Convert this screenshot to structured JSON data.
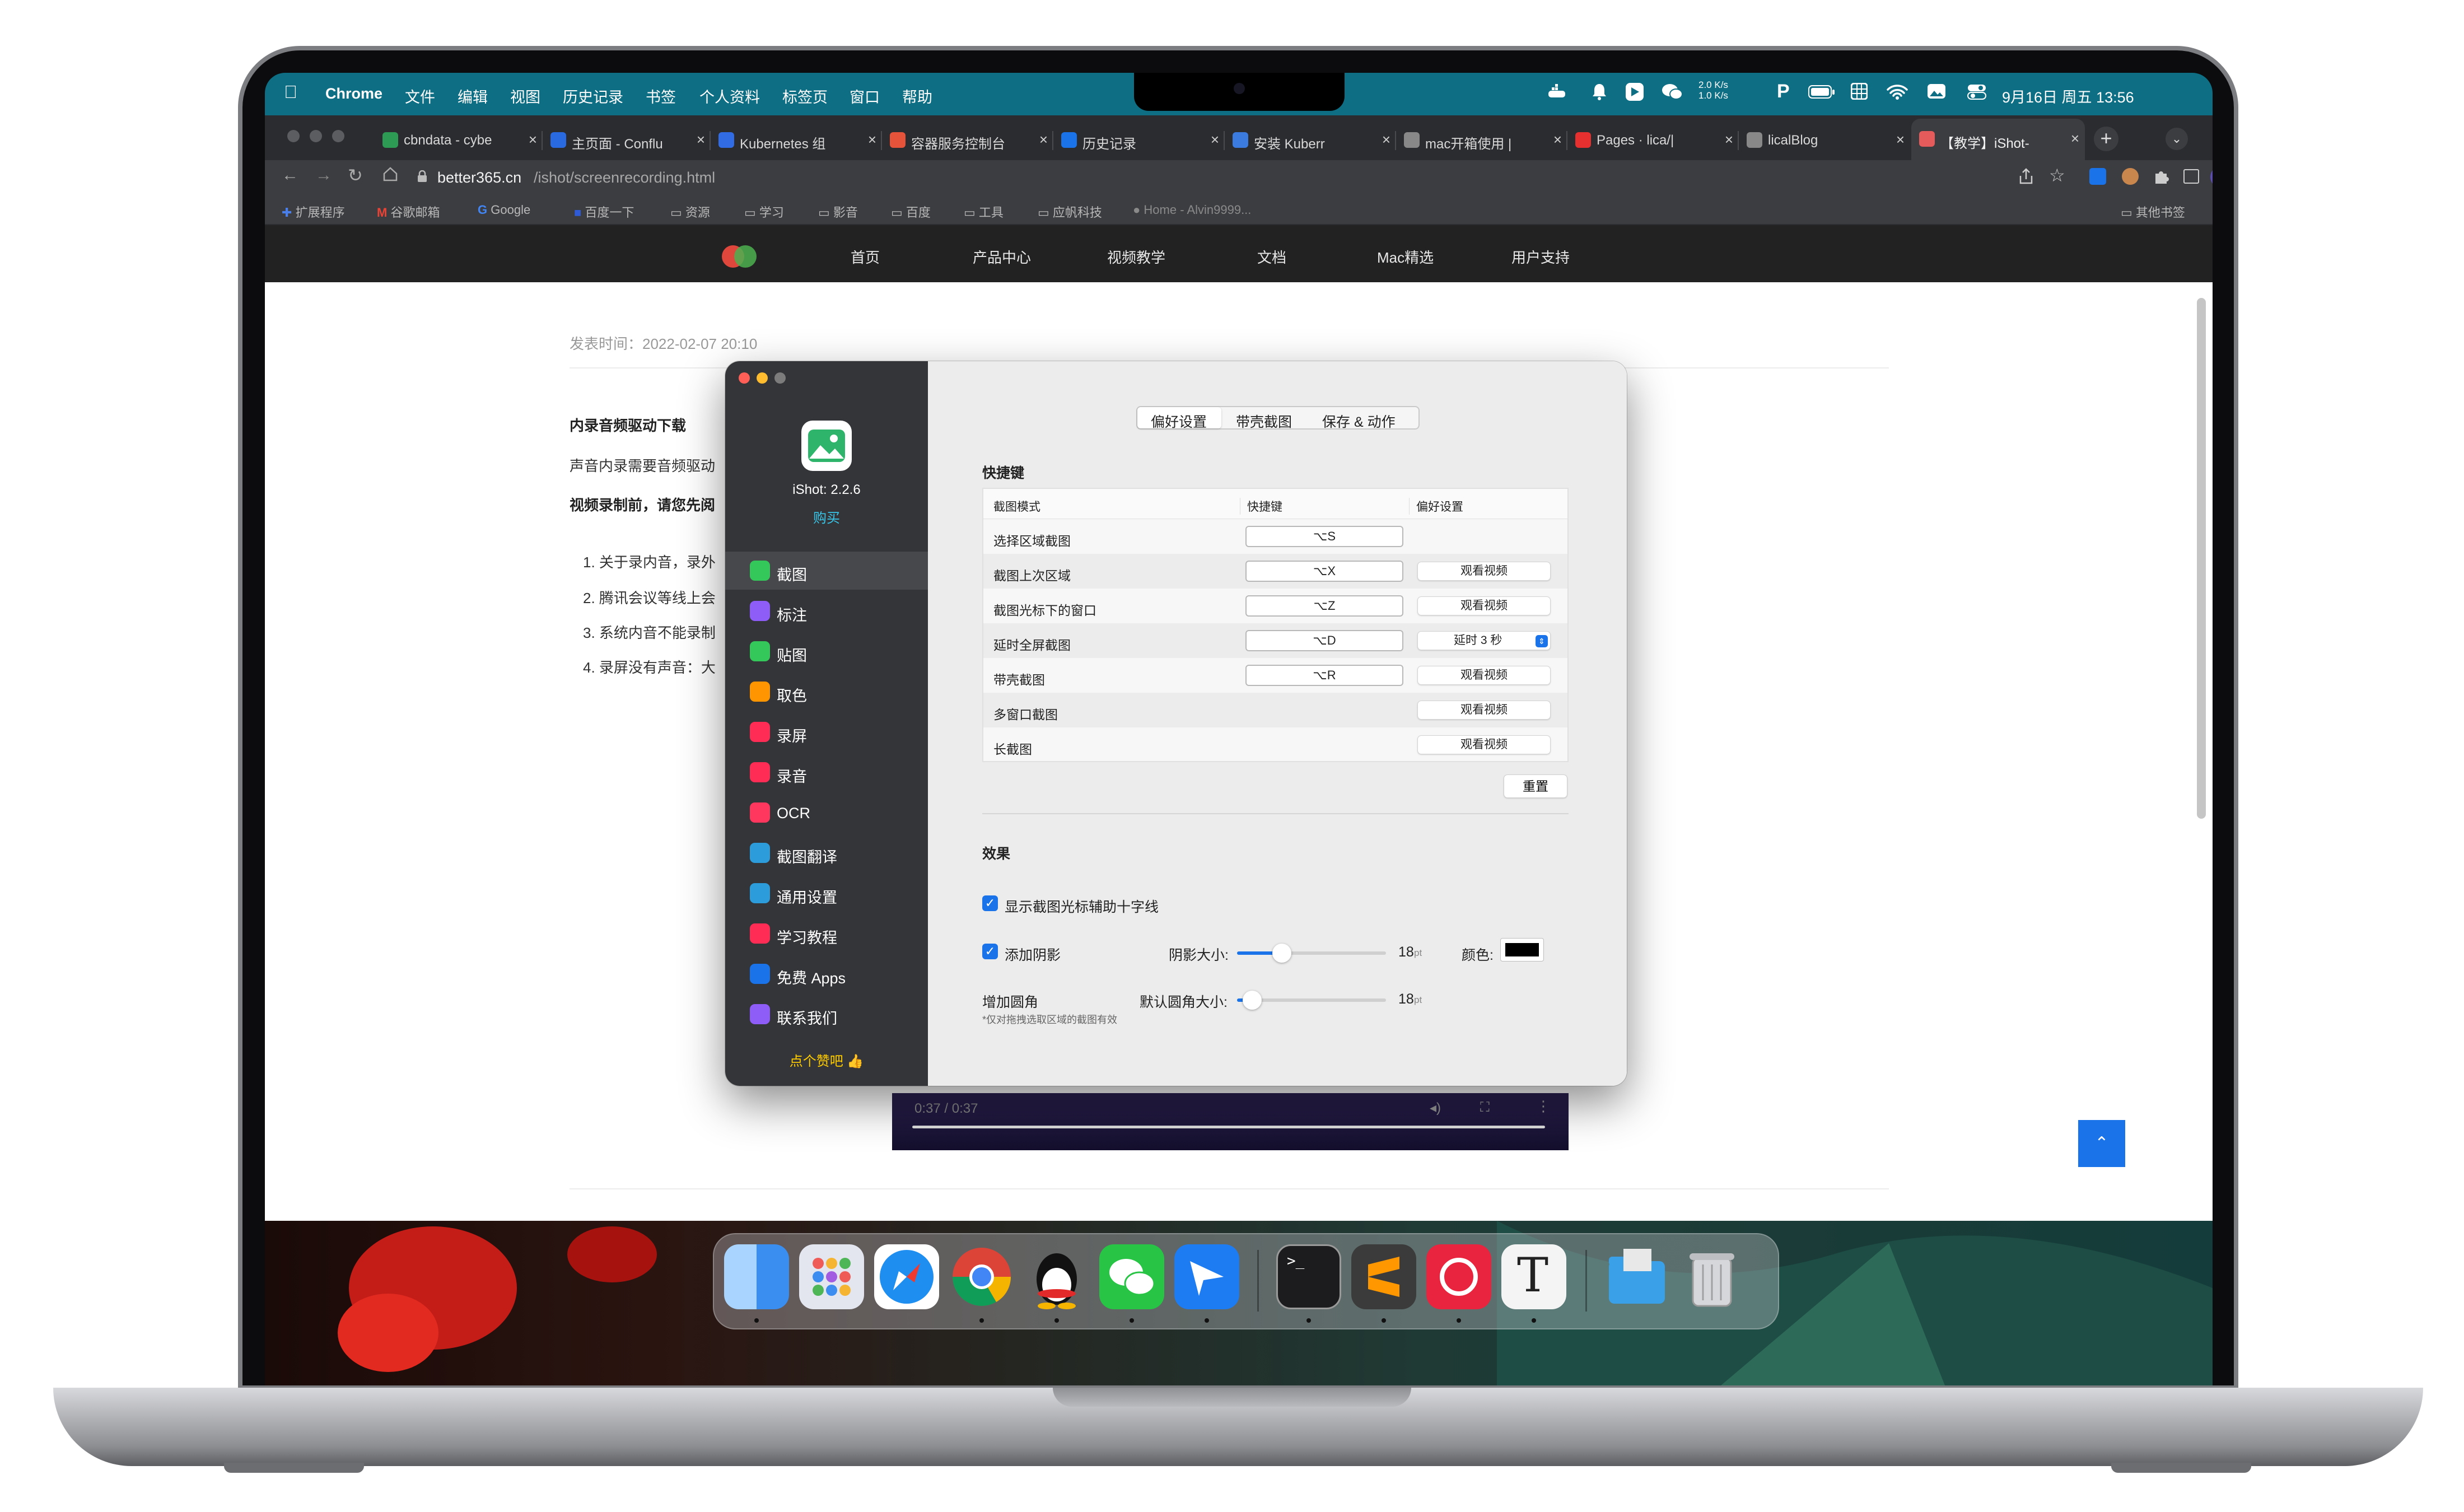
{
  "menubar": {
    "app": "Chrome",
    "items": [
      "文件",
      "编辑",
      "视图",
      "历史记录",
      "书签",
      "个人资料",
      "标签页",
      "窗口",
      "帮助"
    ],
    "net_up": "2.0 K/s",
    "net_down": "1.0 K/s",
    "clock": "9月16日 周五 13:56"
  },
  "tabs": [
    {
      "title": "cbndata - cybe",
      "icon_color": "#2e9b55"
    },
    {
      "title": "主页面 - Conflu",
      "icon_color": "#2a6ae0"
    },
    {
      "title": "Kubernetes 组",
      "icon_color": "#326ce5"
    },
    {
      "title": "容器服务控制台",
      "icon_color": "#e5533b"
    },
    {
      "title": "历史记录",
      "icon_color": "#1a73e8"
    },
    {
      "title": "安装 Kuberr",
      "icon_color": "#3b7be0"
    },
    {
      "title": "mac开箱使用 |",
      "icon_color": "#888888"
    },
    {
      "title": "Pages · lica/|",
      "icon_color": "#e5302f"
    },
    {
      "title": "licalBlog",
      "icon_color": "#888888"
    },
    {
      "title": "【教学】iShot-",
      "icon_color": "#e55a5a"
    }
  ],
  "address": {
    "domain": "better365.cn",
    "path": "/ishot/screenrecording.html"
  },
  "bookmarks": [
    "扩展程序",
    "谷歌邮箱",
    "Google",
    "百度一下",
    "资源",
    "学习",
    "影音",
    "百度",
    "工具",
    "应帆科技",
    "Home - Alvin9999..."
  ],
  "other_bookmarks": "其他书签",
  "site": {
    "nav": [
      "首页",
      "产品中心",
      "视频教学",
      "文档",
      "Mac精选",
      "用户支持"
    ],
    "post_time": "发表时间：2022-02-07 20:10",
    "h_text": "内录音频驱动下载",
    "p1": "声音内录需要音频驱动",
    "p2": "视频录制前，请您先阅",
    "list": [
      "1. 关于录内音，录外",
      "2. 腾讯会议等线上会",
      "3. 系统内音不能录制",
      "4. 录屏没有声音：大"
    ],
    "video_time": "0:37 / 0:37",
    "scrolltop_icon": "chevron-up-icon"
  },
  "ishot": {
    "version": "iShot: 2.2.6",
    "buy": "购买",
    "sidebar": [
      {
        "label": "截图",
        "color": "#34c759",
        "icon": "image-icon"
      },
      {
        "label": "标注",
        "color": "#8e5cf7",
        "icon": "pointer-icon"
      },
      {
        "label": "贴图",
        "color": "#34c759",
        "icon": "pin-icon"
      },
      {
        "label": "取色",
        "color": "#ff9500",
        "icon": "color-picker-icon"
      },
      {
        "label": "录屏",
        "color": "#ff2d55",
        "icon": "video-icon"
      },
      {
        "label": "录音",
        "color": "#ff2d55",
        "icon": "mic-icon"
      },
      {
        "label": "OCR",
        "color": "#ff375f",
        "icon": "ocr-icon"
      },
      {
        "label": "截图翻译",
        "color": "#2d9cdb",
        "icon": "translate-icon"
      },
      {
        "label": "通用设置",
        "color": "#2d9cdb",
        "icon": "gear-icon"
      },
      {
        "label": "学习教程",
        "color": "#ff2d55",
        "icon": "book-icon"
      },
      {
        "label": "免费 Apps",
        "color": "#1a73e8",
        "icon": "appstore-icon"
      },
      {
        "label": "联系我们",
        "color": "#8e5cf7",
        "icon": "contact-icon"
      }
    ],
    "like": "点个赞吧 👍",
    "segments": [
      "偏好设置",
      "带壳截图",
      "保存 & 动作"
    ],
    "shortcuts_title": "快捷键",
    "table_headers": [
      "截图模式",
      "快捷键",
      "偏好设置"
    ],
    "rows": [
      {
        "mode": "选择区域截图",
        "key": "⌥S",
        "pref": ""
      },
      {
        "mode": "截图上次区域",
        "key": "⌥X",
        "pref": "观看视频"
      },
      {
        "mode": "截图光标下的窗口",
        "key": "⌥Z",
        "pref": "观看视频"
      },
      {
        "mode": "延时全屏截图",
        "key": "⌥D",
        "pref": "延时 3 秒"
      },
      {
        "mode": "带壳截图",
        "key": "⌥R",
        "pref": "观看视频"
      },
      {
        "mode": "多窗口截图",
        "key": "",
        "pref": "观看视频"
      },
      {
        "mode": "长截图",
        "key": "",
        "pref": "观看视频"
      }
    ],
    "reset": "重置",
    "effects_title": "效果",
    "crosshair": "显示截图光标辅助十字线",
    "shadow": "添加阴影",
    "shadow_size_label": "阴影大小:",
    "shadow_size": "18",
    "shadow_level": 0.3,
    "unit": "pt",
    "color_label": "颜色:",
    "shadow_color": "#000000",
    "round": "增加圆角",
    "round_size_label": "默认圆角大小:",
    "round_size": "18",
    "round_level": 0.1,
    "round_note": "*仅对拖拽选取区域的截图有效"
  }
}
